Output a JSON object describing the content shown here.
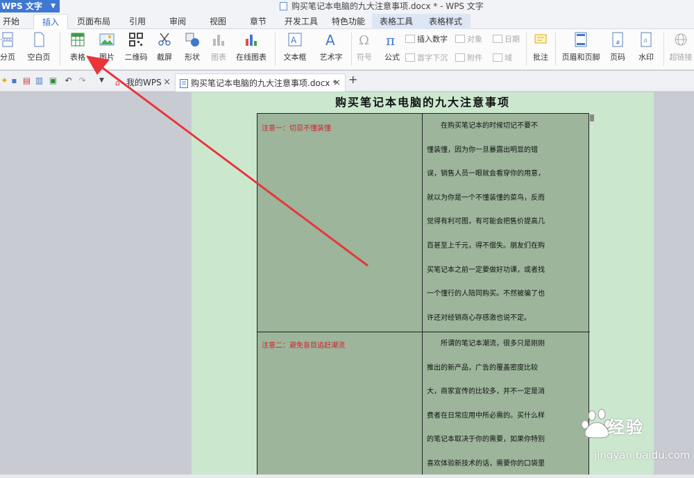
{
  "titlebar": {
    "app_name": "WPS 文字",
    "document_title": "购买笔记本电脑的九大注意事项.docx * - WPS 文字"
  },
  "ribbon_tabs": [
    "开始",
    "插入",
    "页面布局",
    "引用",
    "审阅",
    "视图",
    "章节",
    "开发工具",
    "特色功能",
    "表格工具",
    "表格样式"
  ],
  "active_tab": "插入",
  "ribbon": {
    "page_break": "分页",
    "blank_page": "空白页",
    "table": "表格",
    "picture": "图片",
    "qrcode": "二维码",
    "screenshot": "截屏",
    "shapes": "形状",
    "chart": "图表",
    "online_chart": "在线图表",
    "textbox": "文本框",
    "wordart": "艺术字",
    "symbol": "符号",
    "formula": "公式",
    "insert_number": "插入数字",
    "object": "对象",
    "date": "日期",
    "drop_cap": "首字下沉",
    "attachment": "附件",
    "field": "域",
    "comment": "批注",
    "header_footer": "页眉和页脚",
    "page_number": "页码",
    "watermark": "水印",
    "hyperlink": "超链接"
  },
  "doc_tabs": [
    {
      "label": "我的WPS",
      "close": "×"
    },
    {
      "label": "购买笔记本电脑的九大注意事项.docx *",
      "close": "×"
    }
  ],
  "new_tab": "+",
  "document": {
    "heading": "购买笔记本电脑的九大注意事项",
    "rows": [
      {
        "left": "注意一：切忌不懂装懂",
        "right_lines": [
          "　　在购买笔记本的时候切记不要不",
          "懂装懂，因为你一旦暴露出明显的错",
          "误，销售人员一眼就会看穿你的用意，",
          "就以为你是一个不懂装懂的菜鸟，反而",
          "觉得有利可图，有可能会把售价提高几",
          "百甚至上千元，得不偿失。朋友们在购",
          "买笔记本之前一定要做好功课，或者找",
          "一个懂行的人陪同购买。不然被骗了也",
          "许还对经销商心存感激也说不定。"
        ]
      },
      {
        "left": "注意二：避免盲目追赶潮流",
        "right_lines": [
          "　　所谓的笔记本潮流，很多只是刚刚",
          "推出的新产品，广告的覆盖密度比较",
          "大，商家宣传的比较多，并不一定是消",
          "费者在日常应用中所必需的。买什么样",
          "的笔记本取决于你的需要，如果你特别",
          "喜欢体验新技术的话，需要你的口袋里"
        ]
      }
    ]
  },
  "watermark": {
    "brand": "经验",
    "url": "jingyan.baidu.com"
  },
  "colors": {
    "app_blue": "#3e78d0",
    "page_green": "#cbe8cf",
    "table_fill": "#9cb59b",
    "annotation_red": "#e8353a",
    "note_red": "#d4202a"
  }
}
